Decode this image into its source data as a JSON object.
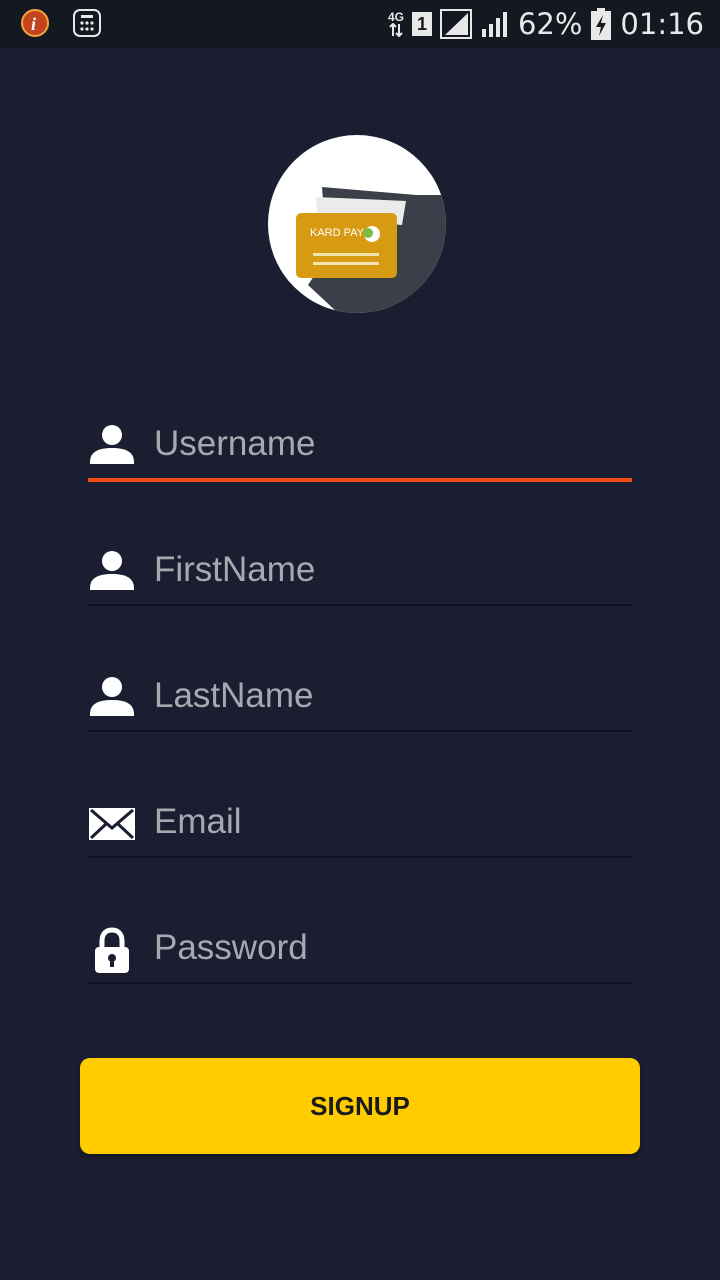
{
  "status_bar": {
    "network_type": "4G",
    "sim_slot": "1",
    "battery": "62%",
    "time": "01:16"
  },
  "logo": {
    "brand_text": "KARD PAY",
    "card_color": "#d79a13"
  },
  "form": {
    "username_placeholder": "Username",
    "firstname_placeholder": "FirstName",
    "lastname_placeholder": "LastName",
    "email_placeholder": "Email",
    "password_placeholder": "Password"
  },
  "signup_label": "SIGNUP",
  "colors": {
    "background": "#1a1e30",
    "accent_underline": "#f04a17",
    "button": "#ffcc00"
  }
}
